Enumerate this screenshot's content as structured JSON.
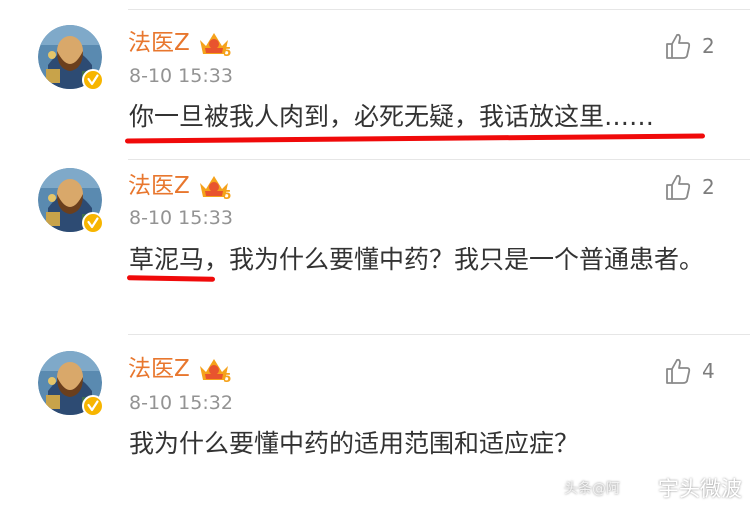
{
  "comments": [
    {
      "username": "法医Z",
      "crown_level": "5",
      "time": "8-10 15:33",
      "text": "你一旦被我人肉到，必死无疑，我话放这里……",
      "likes": "2"
    },
    {
      "username": "法医Z",
      "crown_level": "5",
      "time": "8-10 15:33",
      "text": "草泥马，我为什么要懂中药？我只是一个普通患者。",
      "likes": "2"
    },
    {
      "username": "法医Z",
      "crown_level": "5",
      "time": "8-10 15:32",
      "text": "我为什么要懂中药的适用范围和适应症？",
      "likes": "4"
    }
  ],
  "watermark": {
    "faint": "头条@阿",
    "label": "宇头微波"
  },
  "colors": {
    "username": "#e8772e",
    "underline": "#f00a0a",
    "time": "#939393",
    "text": "#333333"
  },
  "icons": {
    "like": "thumbs-up-icon",
    "verified": "verified-badge-icon",
    "crown": "crown-vip-icon",
    "weibo": "weibo-logo-icon"
  }
}
